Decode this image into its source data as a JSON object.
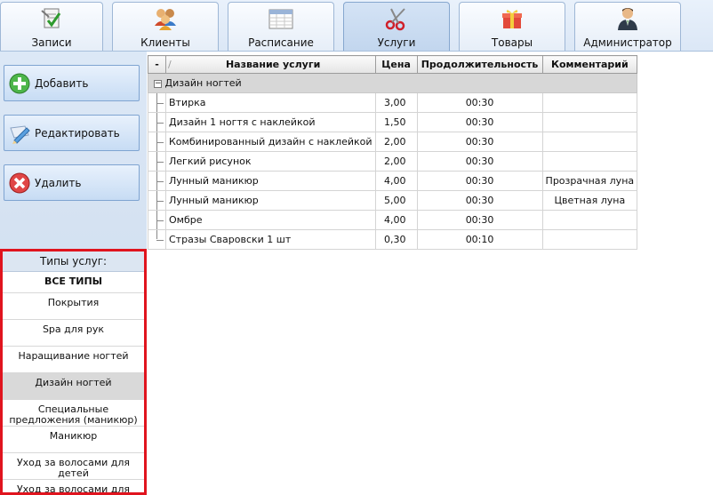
{
  "tabs": [
    {
      "label": "Записи",
      "icon": "notes-check-icon",
      "active": false
    },
    {
      "label": "Клиенты",
      "icon": "clients-group-icon",
      "active": false
    },
    {
      "label": "Расписание",
      "icon": "schedule-calendar-icon",
      "active": false
    },
    {
      "label": "Услуги",
      "icon": "scissors-icon",
      "active": true
    },
    {
      "label": "Товары",
      "icon": "gift-box-icon",
      "active": false
    },
    {
      "label": "Администратор",
      "icon": "admin-person-icon",
      "active": false
    }
  ],
  "actions": {
    "add": {
      "label": "Добавить",
      "icon": "plus-circle-icon"
    },
    "edit": {
      "label": "Редактировать",
      "icon": "pencil-edit-icon"
    },
    "delete": {
      "label": "Удалить",
      "icon": "delete-x-icon"
    }
  },
  "types_panel": {
    "title": "Типы услуг:",
    "items": [
      {
        "label": "ВСЕ ТИПЫ",
        "bold": true,
        "selected": false
      },
      {
        "label": "Покрытия",
        "bold": false,
        "selected": false
      },
      {
        "label": "Spa для рук",
        "bold": false,
        "selected": false
      },
      {
        "label": "Наращивание ногтей",
        "bold": false,
        "selected": false
      },
      {
        "label": "Дизайн ногтей",
        "bold": false,
        "selected": true
      },
      {
        "label": "Специальные предложения (маникюр)",
        "bold": false,
        "selected": false
      },
      {
        "label": "Маникюр",
        "bold": false,
        "selected": false
      },
      {
        "label": "Уход за волосами для детей",
        "bold": false,
        "selected": false
      },
      {
        "label": "Уход за волосами для мужчин",
        "bold": false,
        "selected": false
      }
    ]
  },
  "grid": {
    "collapse_header": "-",
    "sort_marker": "/",
    "columns": [
      "Название услуги",
      "Цена",
      "Продолжительность",
      "Комментарий"
    ],
    "group": {
      "expander": "−",
      "label": "Дизайн ногтей"
    },
    "rows": [
      [
        "Втирка",
        "3,00",
        "00:30",
        ""
      ],
      [
        "Дизайн 1 ногтя с наклейкой",
        "1,50",
        "00:30",
        ""
      ],
      [
        "Комбинированный дизайн с наклейкой",
        "2,00",
        "00:30",
        ""
      ],
      [
        "Легкий рисунок",
        "2,00",
        "00:30",
        ""
      ],
      [
        "Лунный маникюр",
        "4,00",
        "00:30",
        "Прозрачная луна"
      ],
      [
        "Лунный маникюр",
        "5,00",
        "00:30",
        "Цветная луна"
      ],
      [
        "Омбре",
        "4,00",
        "00:30",
        ""
      ],
      [
        "Стразы Сваровски 1 шт",
        "0,30",
        "00:10",
        ""
      ]
    ]
  }
}
